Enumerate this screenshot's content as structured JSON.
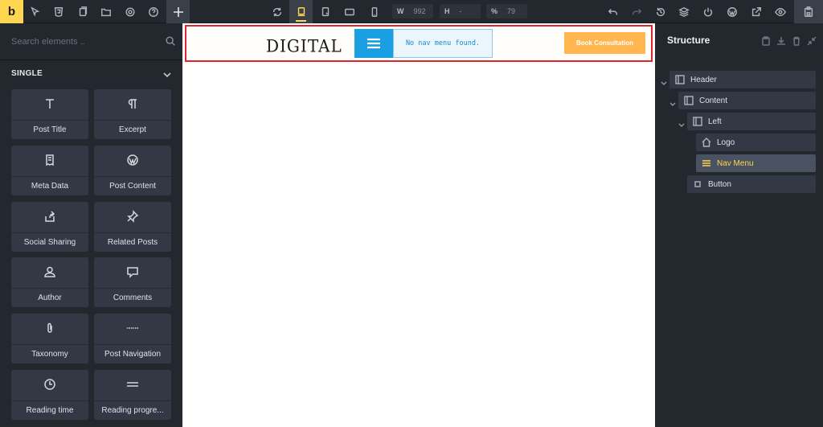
{
  "toolbar": {
    "logo_letter": "b",
    "left_icons": [
      "select-icon",
      "html5-icon",
      "pages-icon",
      "folder-icon",
      "settings-icon",
      "help-icon",
      "add-icon"
    ],
    "center_icons": [
      "refresh-icon",
      "desktop-icon",
      "tablet-landscape-icon",
      "tablet-icon",
      "mobile-icon"
    ],
    "width": {
      "label": "W",
      "value": "992"
    },
    "height": {
      "label": "H",
      "value": "-"
    },
    "zoom": {
      "label": "%",
      "value": "79"
    },
    "right_icons": [
      "undo-icon",
      "redo-icon",
      "history-icon",
      "layers-icon",
      "power-icon",
      "wordpress-icon",
      "external-link-icon",
      "preview-icon",
      "save-icon"
    ]
  },
  "left_panel": {
    "search_placeholder": "Search elements ..",
    "section_title": "SINGLE",
    "elements": [
      {
        "label": "Post Title",
        "icon": "text-icon"
      },
      {
        "label": "Excerpt",
        "icon": "paragraph-icon"
      },
      {
        "label": "Meta Data",
        "icon": "receipt-icon"
      },
      {
        "label": "Post Content",
        "icon": "wordpress-icon"
      },
      {
        "label": "Social Sharing",
        "icon": "share-icon"
      },
      {
        "label": "Related Posts",
        "icon": "pin-icon"
      },
      {
        "label": "Author",
        "icon": "user-icon"
      },
      {
        "label": "Comments",
        "icon": "comment-icon"
      },
      {
        "label": "Taxonomy",
        "icon": "paperclip-icon"
      },
      {
        "label": "Post Navigation",
        "icon": "dots-line-icon"
      },
      {
        "label": "Reading time",
        "icon": "clock-icon"
      },
      {
        "label": "Reading progre...",
        "icon": "progress-line-icon"
      }
    ]
  },
  "canvas": {
    "brand": "DIGITAL",
    "nav_message": "No nav menu found.",
    "cta_label": "Book Consultation",
    "colors": {
      "accent_blue": "#1aa0e2",
      "cta_orange": "#ffb64f",
      "selection_red": "#e0242b"
    }
  },
  "structure": {
    "title": "Structure",
    "items": [
      {
        "label": "Header",
        "icon": "section-icon"
      },
      {
        "label": "Content",
        "icon": "section-icon"
      },
      {
        "label": "Left",
        "icon": "section-icon"
      },
      {
        "label": "Logo",
        "icon": "home-icon"
      },
      {
        "label": "Nav Menu",
        "icon": "menu-icon",
        "selected": true
      },
      {
        "label": "Button",
        "icon": "square-icon"
      }
    ]
  }
}
